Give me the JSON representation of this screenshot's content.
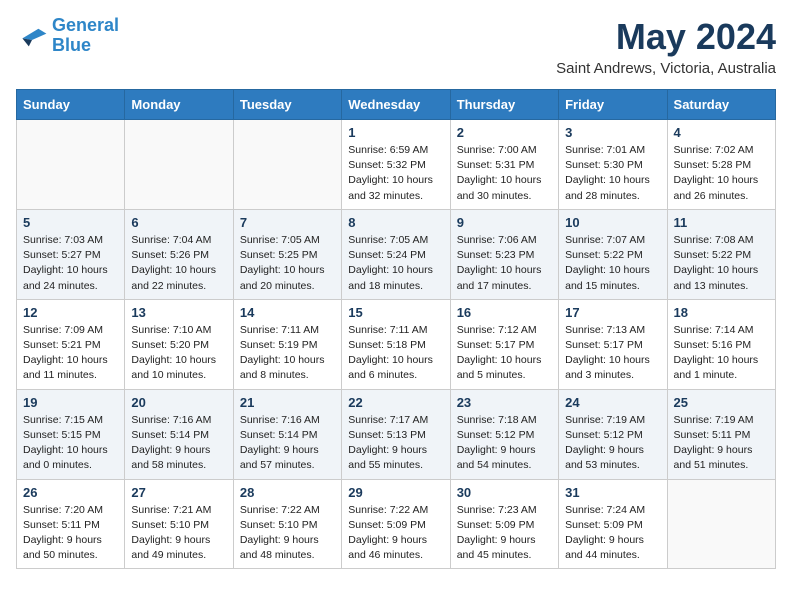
{
  "logo": {
    "line1": "General",
    "line2": "Blue"
  },
  "title": "May 2024",
  "location": "Saint Andrews, Victoria, Australia",
  "days_header": [
    "Sunday",
    "Monday",
    "Tuesday",
    "Wednesday",
    "Thursday",
    "Friday",
    "Saturday"
  ],
  "weeks": [
    [
      {
        "num": "",
        "info": ""
      },
      {
        "num": "",
        "info": ""
      },
      {
        "num": "",
        "info": ""
      },
      {
        "num": "1",
        "info": "Sunrise: 6:59 AM\nSunset: 5:32 PM\nDaylight: 10 hours\nand 32 minutes."
      },
      {
        "num": "2",
        "info": "Sunrise: 7:00 AM\nSunset: 5:31 PM\nDaylight: 10 hours\nand 30 minutes."
      },
      {
        "num": "3",
        "info": "Sunrise: 7:01 AM\nSunset: 5:30 PM\nDaylight: 10 hours\nand 28 minutes."
      },
      {
        "num": "4",
        "info": "Sunrise: 7:02 AM\nSunset: 5:28 PM\nDaylight: 10 hours\nand 26 minutes."
      }
    ],
    [
      {
        "num": "5",
        "info": "Sunrise: 7:03 AM\nSunset: 5:27 PM\nDaylight: 10 hours\nand 24 minutes."
      },
      {
        "num": "6",
        "info": "Sunrise: 7:04 AM\nSunset: 5:26 PM\nDaylight: 10 hours\nand 22 minutes."
      },
      {
        "num": "7",
        "info": "Sunrise: 7:05 AM\nSunset: 5:25 PM\nDaylight: 10 hours\nand 20 minutes."
      },
      {
        "num": "8",
        "info": "Sunrise: 7:05 AM\nSunset: 5:24 PM\nDaylight: 10 hours\nand 18 minutes."
      },
      {
        "num": "9",
        "info": "Sunrise: 7:06 AM\nSunset: 5:23 PM\nDaylight: 10 hours\nand 17 minutes."
      },
      {
        "num": "10",
        "info": "Sunrise: 7:07 AM\nSunset: 5:22 PM\nDaylight: 10 hours\nand 15 minutes."
      },
      {
        "num": "11",
        "info": "Sunrise: 7:08 AM\nSunset: 5:22 PM\nDaylight: 10 hours\nand 13 minutes."
      }
    ],
    [
      {
        "num": "12",
        "info": "Sunrise: 7:09 AM\nSunset: 5:21 PM\nDaylight: 10 hours\nand 11 minutes."
      },
      {
        "num": "13",
        "info": "Sunrise: 7:10 AM\nSunset: 5:20 PM\nDaylight: 10 hours\nand 10 minutes."
      },
      {
        "num": "14",
        "info": "Sunrise: 7:11 AM\nSunset: 5:19 PM\nDaylight: 10 hours\nand 8 minutes."
      },
      {
        "num": "15",
        "info": "Sunrise: 7:11 AM\nSunset: 5:18 PM\nDaylight: 10 hours\nand 6 minutes."
      },
      {
        "num": "16",
        "info": "Sunrise: 7:12 AM\nSunset: 5:17 PM\nDaylight: 10 hours\nand 5 minutes."
      },
      {
        "num": "17",
        "info": "Sunrise: 7:13 AM\nSunset: 5:17 PM\nDaylight: 10 hours\nand 3 minutes."
      },
      {
        "num": "18",
        "info": "Sunrise: 7:14 AM\nSunset: 5:16 PM\nDaylight: 10 hours\nand 1 minute."
      }
    ],
    [
      {
        "num": "19",
        "info": "Sunrise: 7:15 AM\nSunset: 5:15 PM\nDaylight: 10 hours\nand 0 minutes."
      },
      {
        "num": "20",
        "info": "Sunrise: 7:16 AM\nSunset: 5:14 PM\nDaylight: 9 hours\nand 58 minutes."
      },
      {
        "num": "21",
        "info": "Sunrise: 7:16 AM\nSunset: 5:14 PM\nDaylight: 9 hours\nand 57 minutes."
      },
      {
        "num": "22",
        "info": "Sunrise: 7:17 AM\nSunset: 5:13 PM\nDaylight: 9 hours\nand 55 minutes."
      },
      {
        "num": "23",
        "info": "Sunrise: 7:18 AM\nSunset: 5:12 PM\nDaylight: 9 hours\nand 54 minutes."
      },
      {
        "num": "24",
        "info": "Sunrise: 7:19 AM\nSunset: 5:12 PM\nDaylight: 9 hours\nand 53 minutes."
      },
      {
        "num": "25",
        "info": "Sunrise: 7:19 AM\nSunset: 5:11 PM\nDaylight: 9 hours\nand 51 minutes."
      }
    ],
    [
      {
        "num": "26",
        "info": "Sunrise: 7:20 AM\nSunset: 5:11 PM\nDaylight: 9 hours\nand 50 minutes."
      },
      {
        "num": "27",
        "info": "Sunrise: 7:21 AM\nSunset: 5:10 PM\nDaylight: 9 hours\nand 49 minutes."
      },
      {
        "num": "28",
        "info": "Sunrise: 7:22 AM\nSunset: 5:10 PM\nDaylight: 9 hours\nand 48 minutes."
      },
      {
        "num": "29",
        "info": "Sunrise: 7:22 AM\nSunset: 5:09 PM\nDaylight: 9 hours\nand 46 minutes."
      },
      {
        "num": "30",
        "info": "Sunrise: 7:23 AM\nSunset: 5:09 PM\nDaylight: 9 hours\nand 45 minutes."
      },
      {
        "num": "31",
        "info": "Sunrise: 7:24 AM\nSunset: 5:09 PM\nDaylight: 9 hours\nand 44 minutes."
      },
      {
        "num": "",
        "info": ""
      }
    ]
  ]
}
